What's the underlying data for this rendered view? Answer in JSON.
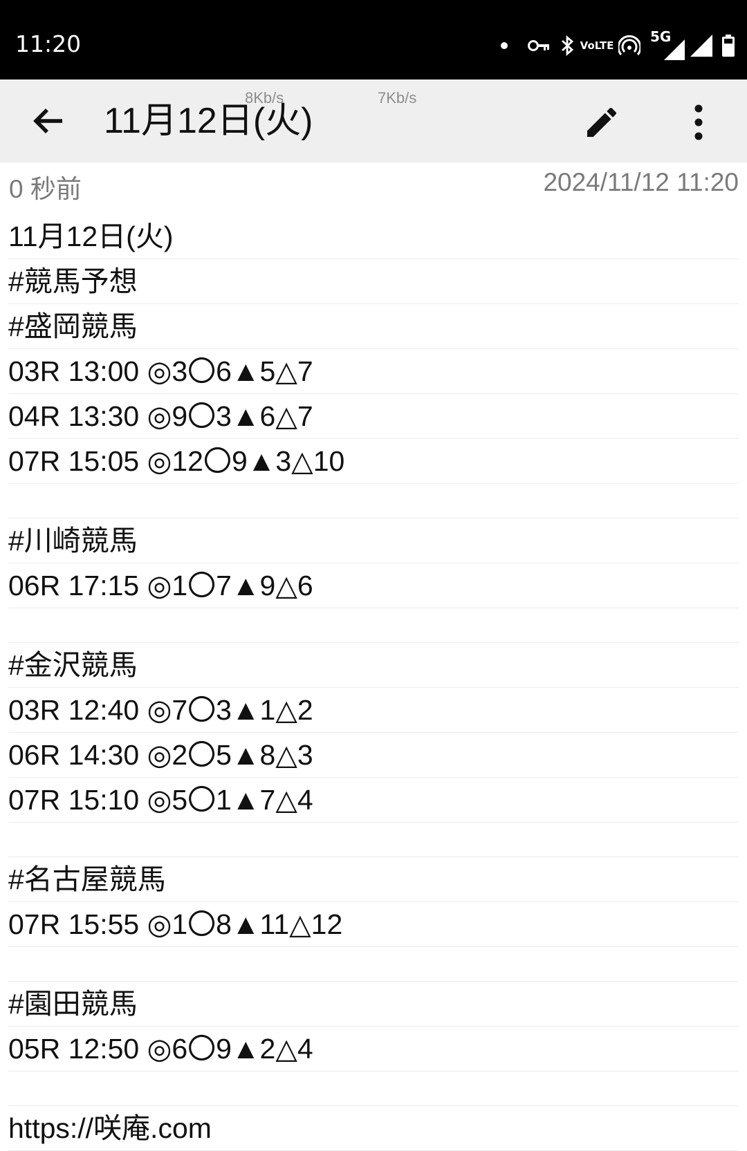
{
  "status_bar": {
    "time": "11:20",
    "icons": [
      "notification-dot",
      "vpn-key-icon",
      "bluetooth-icon",
      "volte-icon",
      "hotspot-icon",
      "5g-signal-icon",
      "signal-icon",
      "battery-icon"
    ],
    "volte_label_top": "Vo",
    "volte_label_bottom": "LTE",
    "network_label": "5G"
  },
  "toolbar": {
    "title": "11月12日(火)",
    "speed_left": "8Kb/s",
    "speed_right": "7Kb/s",
    "back_icon": "arrow-back-icon",
    "edit_icon": "pencil-icon",
    "more_icon": "more-vert-icon"
  },
  "meta": {
    "relative_time": "0 秒前",
    "timestamp": "2024/11/12 11:20"
  },
  "note": {
    "lines": [
      "11月12日(火)",
      "#競馬予想",
      "#盛岡競馬",
      "03R 13:00 ◎3〇6▲5△7",
      "04R 13:30 ◎9〇3▲6△7",
      "07R 15:05 ◎12〇9▲3△10",
      "",
      "#川崎競馬",
      "06R 17:15 ◎1〇7▲9△6",
      "",
      "#金沢競馬",
      "03R 12:40 ◎7〇3▲1△2",
      "06R 14:30 ◎2〇5▲8△3",
      "07R 15:10 ◎5〇1▲7△4",
      "",
      "#名古屋競馬",
      "07R 15:55 ◎1〇8▲11△12",
      "",
      "#園田競馬",
      "05R 12:50 ◎6〇9▲2△4",
      "",
      "https://咲庵.com"
    ]
  },
  "colors": {
    "status_bar_bg": "#000000",
    "toolbar_bg": "#efefef",
    "text": "#111111",
    "meta_text": "#7a7a7a",
    "rule": "#ececec"
  }
}
